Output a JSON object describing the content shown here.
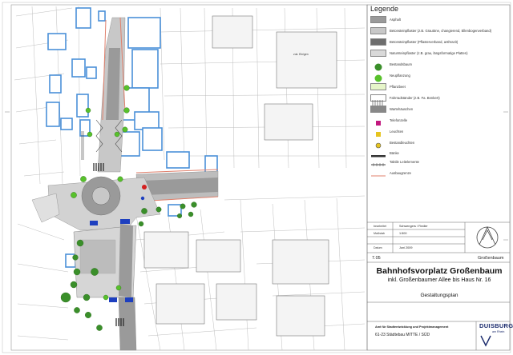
{
  "legend": {
    "title": "Legende",
    "items": [
      {
        "label": "Asphalt",
        "symbol": "asphalt-swatch",
        "color": "#9a9a9a"
      },
      {
        "label": "Betonsteinpflaster (z.B. Grautöne, changierend, Ellenbogenverband)",
        "symbol": "concrete-paving-swatch",
        "color": "#c8c8c8"
      },
      {
        "label": "Betonsteinpflaster (Pflasterverband, anthrazit)",
        "symbol": "anthracite-paving-swatch",
        "color": "#6d6d6d"
      },
      {
        "label": "Natursteinpflaster (z.B. grau, längsformatige Platten)",
        "symbol": "natural-stone-swatch",
        "color": "#d9d9d9"
      },
      {
        "label": "Bestandsbaum",
        "symbol": "existing-tree-icon",
        "color": "#3a8f2a"
      },
      {
        "label": "Neupflanzung",
        "symbol": "new-tree-icon",
        "color": "#58c12b"
      },
      {
        "label": "Pflanzbeet",
        "symbol": "planting-bed-swatch",
        "color": "#e6f5c9"
      },
      {
        "label": "Fahrradständer (z.B. Fa. Benkert)",
        "symbol": "bike-stand-icon",
        "color": "#555555"
      },
      {
        "label": "Wartehäuschen",
        "symbol": "shelter-swatch",
        "color": "#888888"
      },
      {
        "label": "Telefonzelle",
        "symbol": "phone-booth-icon",
        "color": "#c2187e"
      },
      {
        "label": "Leuchten",
        "symbol": "lamp-icon",
        "color": "#e6c41f"
      },
      {
        "label": "Bestandleuchten",
        "symbol": "existing-lamp-icon",
        "color": "#e6c41f"
      },
      {
        "label": "Bänke",
        "symbol": "bench-icon",
        "color": "#333333"
      },
      {
        "label": "Taktile Leitelemente",
        "symbol": "tactile-element-icon",
        "color": "#444444"
      },
      {
        "label": "Ausbaugrenze",
        "symbol": "construction-boundary-line",
        "color": "#e0806c"
      }
    ]
  },
  "title_block": {
    "fields": [
      {
        "label": "bearbeitet",
        "value": "Schwengers / Fiedler"
      },
      {
        "label": "Maßstab",
        "value": "1:500"
      },
      {
        "label": "Datum",
        "value": "Juni 2009"
      }
    ],
    "plan_number": "7.05",
    "place": "Großenbaum",
    "title": "Bahnhofsvorplatz Großenbaum",
    "subtitle": "inkl. Großenbaumer Allee bis Haus Nr. 16",
    "plan_type": "Gestaltungsplan",
    "department": "Amt für Stadtentwicklung und Projektmanagement",
    "department_line2": "61-23  Städtebau MITTE / SÜD",
    "logo_main": "DUISBURG",
    "logo_sub": "am Rhein"
  },
  "map": {
    "labels": [
      "zuk. Ein/gen"
    ],
    "colors": {
      "building_outline": "#4a90d9",
      "asphalt": "#9a9a9a",
      "paving": "#c8c8c8",
      "boundary": "#e0806c",
      "tree": "#3a8f2a",
      "new_tree": "#58c12b",
      "bus": "#1d3fbf"
    }
  }
}
